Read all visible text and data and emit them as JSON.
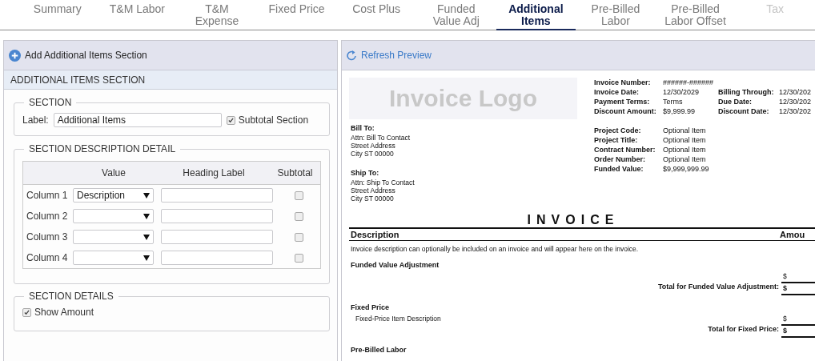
{
  "tabs": [
    {
      "label": "Summary",
      "selected": false,
      "disabled": false
    },
    {
      "label": "T&M Labor",
      "selected": false,
      "disabled": false
    },
    {
      "label": "T&M Expense",
      "selected": false,
      "disabled": false
    },
    {
      "label": "Fixed Price",
      "selected": false,
      "disabled": false
    },
    {
      "label": "Cost Plus",
      "selected": false,
      "disabled": false
    },
    {
      "label": "Funded Value Adj",
      "selected": false,
      "disabled": false
    },
    {
      "label": "Additional Items",
      "selected": true,
      "disabled": false
    },
    {
      "label": "Pre-Billed Labor",
      "selected": false,
      "disabled": false
    },
    {
      "label": "Pre-Billed Labor Offset",
      "selected": false,
      "disabled": false
    },
    {
      "label": "Tax",
      "selected": false,
      "disabled": true
    }
  ],
  "editor": {
    "add_button": "Add Additional Items Section",
    "section_header": "ADDITIONAL ITEMS SECTION",
    "section": {
      "legend": "SECTION",
      "label_caption": "Label:",
      "label_value": "Additional Items",
      "subtotal_section": {
        "label": "Subtotal Section",
        "checked": true
      }
    },
    "description_detail": {
      "legend": "SECTION DESCRIPTION DETAIL",
      "headers": [
        "Value",
        "Heading Label",
        "Subtotal"
      ],
      "rows": [
        {
          "label": "Column 1",
          "value": "Description",
          "subtotal": false
        },
        {
          "label": "Column 2",
          "subtotal": false
        },
        {
          "label": "Column 3",
          "subtotal": false
        },
        {
          "label": "Column 4",
          "subtotal": false
        }
      ]
    },
    "section_details": {
      "legend": "SECTION DETAILS",
      "show_amount": {
        "label": "Show Amount",
        "checked": true
      }
    }
  },
  "preview": {
    "refresh_button": "Refresh Preview",
    "invoice": {
      "logo": "Invoice Logo",
      "header_fields": [
        {
          "label": "Invoice Number:",
          "value": "######-######"
        },
        {
          "label": "Invoice Date:",
          "value": "12/30/2029"
        },
        {
          "label": "Payment Terms:",
          "value": "Terms"
        },
        {
          "label": "Discount Amount:",
          "value": "$9,999.99"
        }
      ],
      "billing_fields": [
        {
          "label": "Billing Through:",
          "value": "12/30/202"
        },
        {
          "label": "Due Date:",
          "value": "12/30/202"
        },
        {
          "label": "Discount Date:",
          "value": "12/30/202"
        }
      ],
      "project_fields": [
        {
          "label": "Project Code:",
          "value": "Optional Item"
        },
        {
          "label": "Project Title:",
          "value": "Optional Item"
        },
        {
          "label": "Contract Number:",
          "value": "Optional Item"
        },
        {
          "label": "Order Number:",
          "value": "Optional Item"
        },
        {
          "label": "Funded Value:",
          "value": "$9,999,999.99"
        }
      ],
      "bill_to": {
        "title": "Bill To:",
        "lines": [
          "Attn: Bill To Contact",
          "Street Address",
          "City ST 00000"
        ]
      },
      "ship_to": {
        "title": "Ship To:",
        "lines": [
          "Attn: Ship To Contact",
          "Street Address",
          "City ST 00000"
        ]
      },
      "title": "INVOICE",
      "columns": [
        "Description",
        "Amou"
      ],
      "note": "Invoice description can optionally be included on an invoice and will appear here on the invoice.",
      "sections": [
        {
          "heading": "Funded Value Adjustment",
          "items": [
            {
              "amount": "$"
            }
          ],
          "total_label": "Total for Funded Value Adjustment:",
          "total_amount": "$"
        },
        {
          "heading": "Fixed Price",
          "items": [
            {
              "description": "Fixed-Price Item Description",
              "amount": "$"
            }
          ],
          "total_label": "Total for Fixed Price:",
          "total_amount": "$"
        },
        {
          "heading": "Pre-Billed Labor"
        }
      ]
    }
  }
}
